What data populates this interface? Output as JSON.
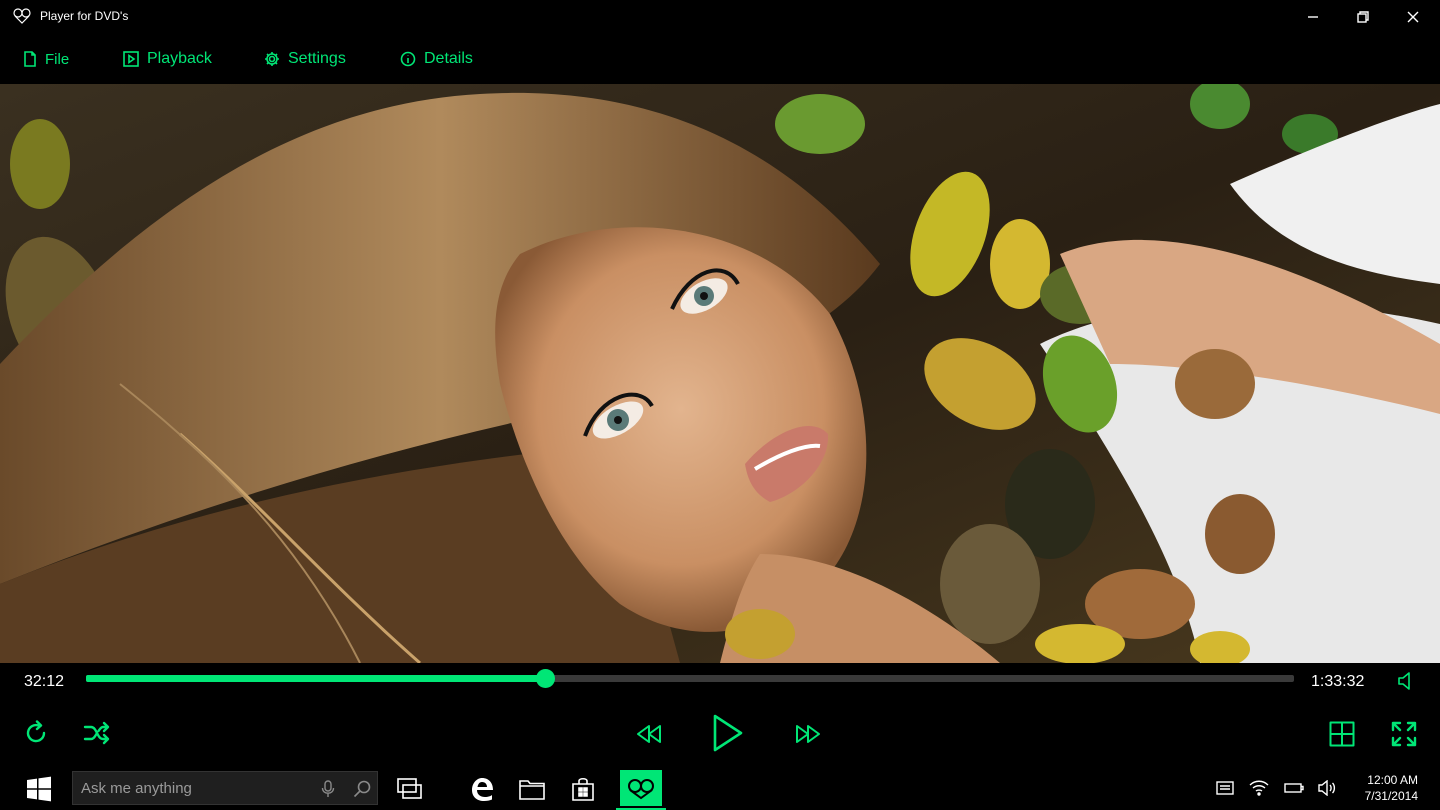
{
  "window": {
    "title": "Player for DVD's"
  },
  "menu": {
    "items": [
      {
        "label": "File",
        "icon": "file-icon"
      },
      {
        "label": "Playback",
        "icon": "playback-icon"
      },
      {
        "label": "Settings",
        "icon": "gear-icon"
      },
      {
        "label": "Details",
        "icon": "info-icon"
      }
    ]
  },
  "video": {
    "description": "video frame: woman lying on autumn leaves",
    "icon": "video-frame"
  },
  "player": {
    "elapsed": "32:12",
    "duration": "1:33:32",
    "progress_percent": 38
  },
  "taskbar": {
    "search_placeholder": "Ask me anything",
    "time": "12:00 AM",
    "date": "7/31/2014"
  },
  "colors": {
    "accent": "#00e676",
    "background": "#000000",
    "track": "#3a3a3a"
  }
}
